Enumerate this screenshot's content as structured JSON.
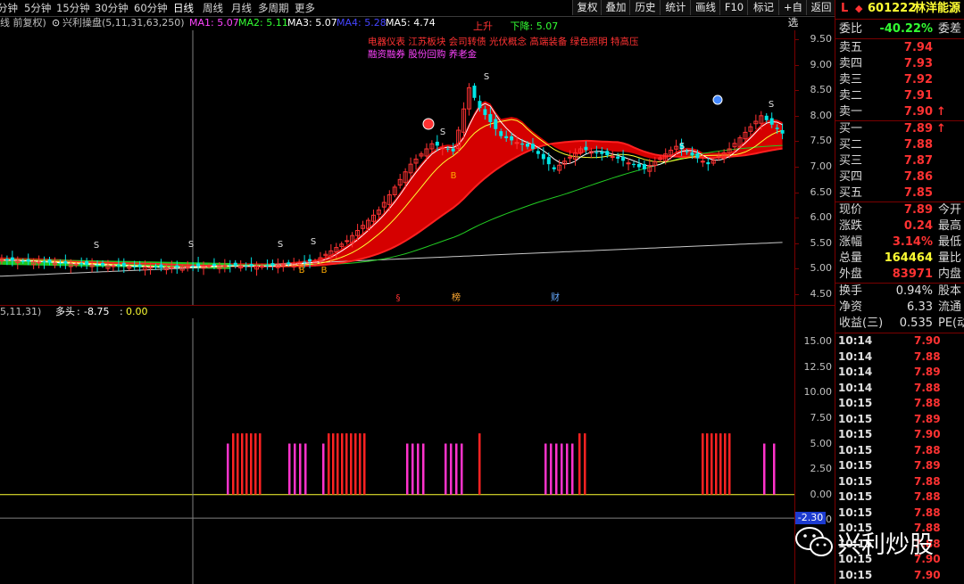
{
  "toolbar": {
    "periods": [
      {
        "label": "分钟",
        "active": false
      },
      {
        "label": "5分钟",
        "active": false
      },
      {
        "label": "15分钟",
        "active": false
      },
      {
        "label": "30分钟",
        "active": false
      },
      {
        "label": "60分钟",
        "active": false
      },
      {
        "label": "日线",
        "active": true
      },
      {
        "label": "周线",
        "active": false
      },
      {
        "label": "月线",
        "active": false
      },
      {
        "label": "多周期",
        "active": false
      },
      {
        "label": "更多",
        "active": false
      }
    ],
    "buttons": [
      "复权",
      "叠加",
      "历史",
      "统计",
      "画线",
      "F10",
      "标记",
      "+自选",
      "返回"
    ]
  },
  "indicator_strip": {
    "period_label": "线 前复权)",
    "formula": "兴利操盘(5,11,31,63,250)",
    "ma": [
      {
        "name": "MA1",
        "value": "5.07",
        "color": "#ff44ff"
      },
      {
        "name": "MA2",
        "value": "5.11",
        "color": "#33ff33"
      },
      {
        "name": "MA3",
        "value": "5.07",
        "color": "#ffffff"
      },
      {
        "name": "MA4",
        "value": "5.28",
        "color": "#4444ff"
      },
      {
        "name": "MA5",
        "value": "4.74",
        "color": "#ffffff"
      }
    ]
  },
  "main_chart": {
    "rise_label": "上升",
    "fall_label": "下降",
    "fall_value": "5.07",
    "concept_line1": "电器仪表 江苏板块 会司转债 光伏概念 高端装备 绿色照明 特高压",
    "concept_line2": "融资融券 股份回购 养老金",
    "markers": [
      "S",
      "S",
      "S",
      "S",
      "S",
      "S",
      "S",
      "B",
      "B",
      "B"
    ],
    "event_labels": [
      "§",
      "榜",
      "财"
    ],
    "y_ticks": [
      "9.50",
      "9.00",
      "8.50",
      "8.00",
      "7.50",
      "7.00",
      "6.50",
      "6.00",
      "5.50",
      "5.00",
      "4.50"
    ]
  },
  "sub_chart": {
    "params": "5,11,31)",
    "name": "多头",
    "value": "-8.75",
    "value2": "0.00",
    "y_ticks": [
      "15.00",
      "12.50",
      "10.00",
      "7.50",
      "5.00",
      "2.50",
      "0.00",
      "-2.50"
    ],
    "current_badge": "-2.30"
  },
  "quote_panel": {
    "code": "601222",
    "name": "林洋能源",
    "wei_bi_label": "委比",
    "wei_bi": "-40.22%",
    "wei_cha_label": "委差",
    "asks": [
      {
        "label": "卖五",
        "price": "7.94"
      },
      {
        "label": "卖四",
        "price": "7.93"
      },
      {
        "label": "卖三",
        "price": "7.92"
      },
      {
        "label": "卖二",
        "price": "7.91"
      },
      {
        "label": "卖一",
        "price": "7.90",
        "arrow": "↑"
      }
    ],
    "bids": [
      {
        "label": "买一",
        "price": "7.89",
        "arrow": "↑"
      },
      {
        "label": "买二",
        "price": "7.88"
      },
      {
        "label": "买三",
        "price": "7.87"
      },
      {
        "label": "买四",
        "price": "7.86"
      },
      {
        "label": "买五",
        "price": "7.85"
      }
    ],
    "stats": [
      {
        "label": "现价",
        "value": "7.89",
        "ext": "今开",
        "color": "#ff3232"
      },
      {
        "label": "涨跌",
        "value": "0.24",
        "ext": "最高",
        "color": "#ff3232"
      },
      {
        "label": "涨幅",
        "value": "3.14%",
        "ext": "最低",
        "color": "#ff3232"
      },
      {
        "label": "总量",
        "value": "164464",
        "ext": "量比",
        "color": "#ffff33"
      },
      {
        "label": "外盘",
        "value": "83971",
        "ext": "内盘",
        "color": "#ff3232"
      }
    ],
    "stats2": [
      {
        "label": "换手",
        "value": "0.94%",
        "ext": "股本",
        "color": "#e0e0e0"
      },
      {
        "label": "净资",
        "value": "6.33",
        "ext": "流通",
        "color": "#e0e0e0"
      },
      {
        "label": "收益(三)",
        "value": "0.535",
        "ext": "PE(动",
        "color": "#e0e0e0"
      }
    ],
    "ticks": [
      {
        "time": "10:14",
        "price": "7.90"
      },
      {
        "time": "10:14",
        "price": "7.88"
      },
      {
        "time": "10:14",
        "price": "7.89"
      },
      {
        "time": "10:14",
        "price": "7.88"
      },
      {
        "time": "10:15",
        "price": "7.88"
      },
      {
        "time": "10:15",
        "price": "7.89"
      },
      {
        "time": "10:15",
        "price": "7.90"
      },
      {
        "time": "10:15",
        "price": "7.88"
      },
      {
        "time": "10:15",
        "price": "7.89"
      },
      {
        "time": "10:15",
        "price": "7.88"
      },
      {
        "time": "10:15",
        "price": "7.88"
      },
      {
        "time": "10:15",
        "price": "7.88"
      },
      {
        "time": "10:15",
        "price": "7.88"
      },
      {
        "time": "10:15",
        "price": "7.88"
      },
      {
        "time": "10:15",
        "price": "7.90"
      },
      {
        "time": "10:15",
        "price": "7.90"
      }
    ]
  },
  "watermark": {
    "text": "兴利炒股"
  },
  "colors": {
    "up": "#ff3232",
    "down": "#00e5e5",
    "grid": "#7a0000",
    "yellow": "#ffff33"
  }
}
